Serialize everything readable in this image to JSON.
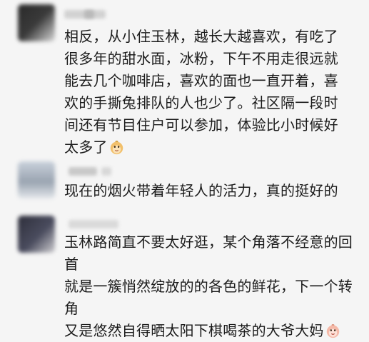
{
  "comments": [
    {
      "text": "相反，从小住玉林，越长大越喜欢，有吃了\n很多年的甜水面，冰粉，下午不用走很远就\n能去几个咖啡店，喜欢的面也一直开着，喜\n欢的手撕兔排队的人也少了。社区隔一段时\n间还有节目住户可以参加，体验比小时候好\n太多了",
      "emoji": "monkey-face-emoji"
    },
    {
      "text": "现在的烟火带着年轻人的活力，真的挺好的"
    },
    {
      "text": "玉林路简直不要太好逛，某个角落不经意的回首\n就是一簇悄然绽放的的各色的鲜花，下一个转角\n又是悠然自得晒太阳下棋喝茶的大爷大妈",
      "emoji": "monkey-face-emoji"
    }
  ],
  "colors": {
    "background": "#f5f5f5",
    "text": "#1b1b1b"
  }
}
